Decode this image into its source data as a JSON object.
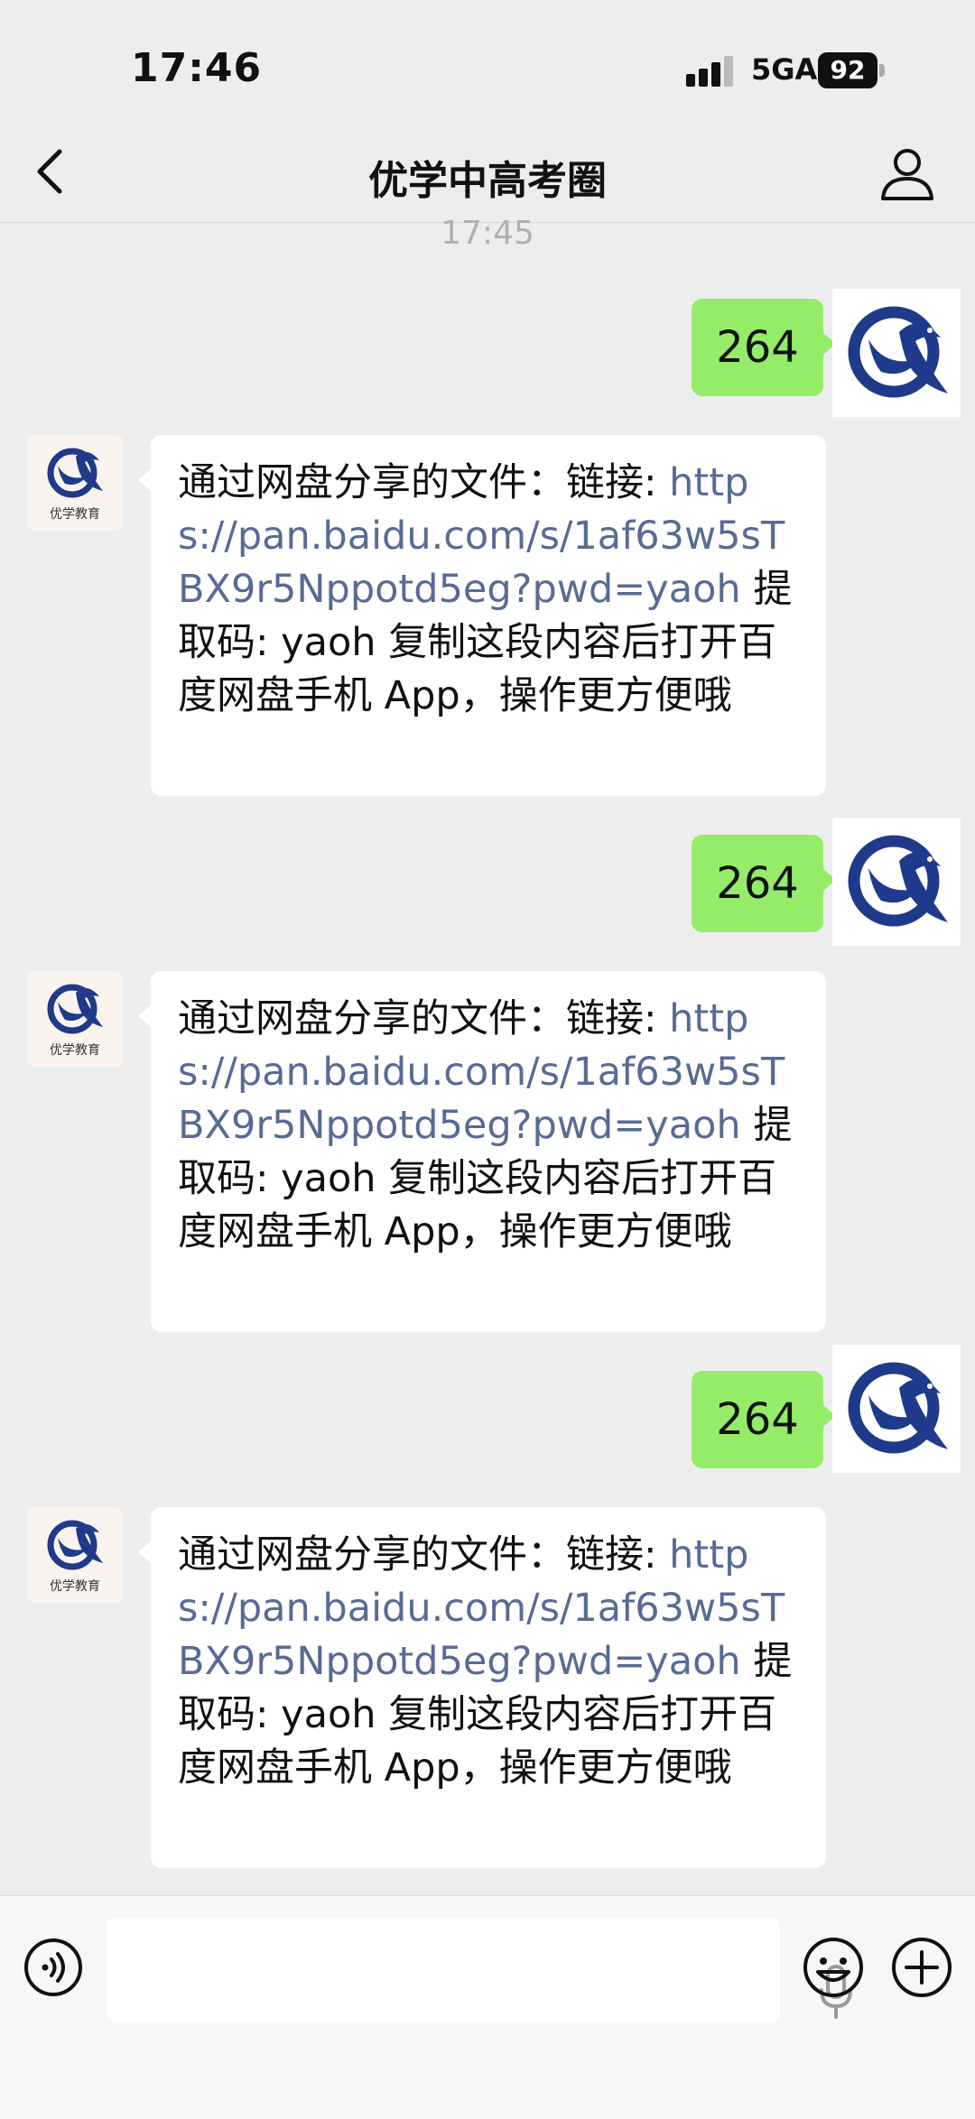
{
  "status_bar": {
    "time": "17:46",
    "network": "5GA",
    "battery": "92"
  },
  "nav": {
    "title": "优学中高考圈"
  },
  "timestamp": "17:45",
  "brand": {
    "logo_text": "优学教育"
  },
  "messages": [
    {
      "from": "me",
      "text": "264"
    },
    {
      "from": "them",
      "prefix": "通过网盘分享的文件：链接: ",
      "link": "https://pan.baidu.com/s/1af63w5sTBX9r5Nppotd5eg?pwd=yaoh",
      "suffix": " 提取码: yaoh 复制这段内容后打开百度网盘手机 App，操作更方便哦"
    },
    {
      "from": "me",
      "text": "264"
    },
    {
      "from": "them",
      "prefix": "通过网盘分享的文件：链接: ",
      "link": "https://pan.baidu.com/s/1af63w5sTBX9r5Nppotd5eg?pwd=yaoh",
      "suffix": " 提取码: yaoh 复制这段内容后打开百度网盘手机 App，操作更方便哦"
    },
    {
      "from": "me",
      "text": "264"
    },
    {
      "from": "them",
      "prefix": "通过网盘分享的文件：链接: ",
      "link": "https://pan.baidu.com/s/1af63w5sTBX9r5Nppotd5eg?pwd=yaoh",
      "suffix": " 提取码: yaoh 复制这段内容后打开百度网盘手机 App，操作更方便哦"
    }
  ],
  "colors": {
    "sent_bubble": "#95ec69",
    "link": "#576b95",
    "logo_blue": "#1f3a8a"
  }
}
